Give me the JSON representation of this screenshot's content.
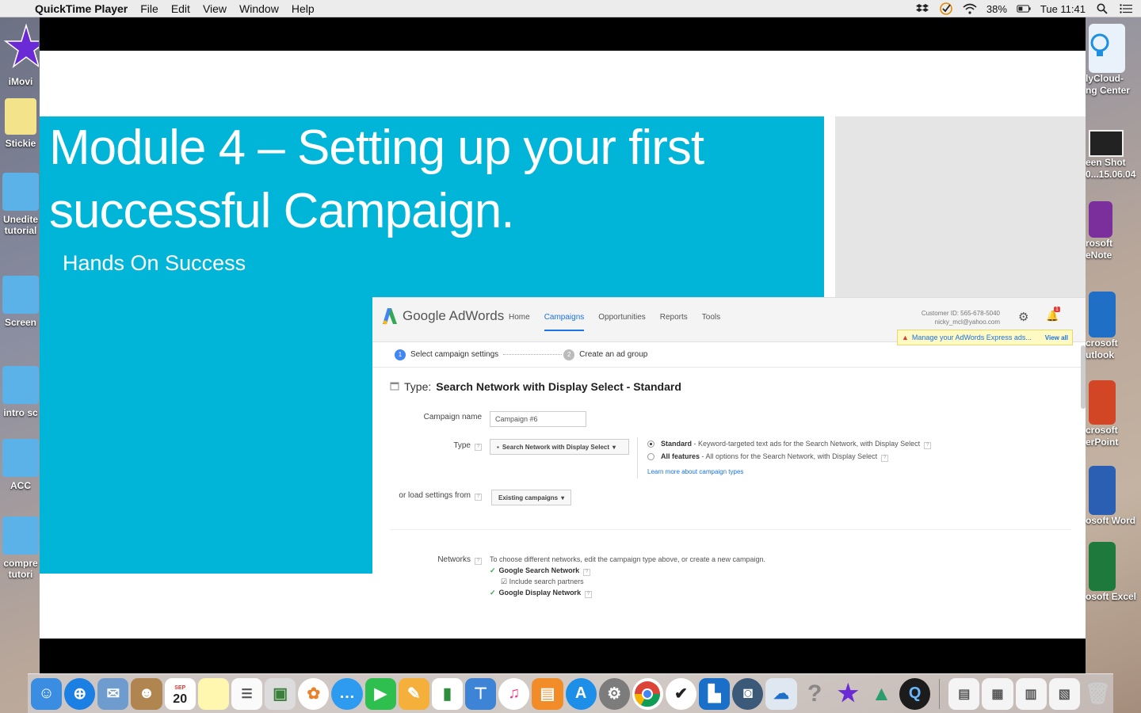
{
  "menubar": {
    "app_name": "QuickTime Player",
    "menus": [
      "File",
      "Edit",
      "View",
      "Window",
      "Help"
    ],
    "battery": "38%",
    "clock": "Tue 11:41"
  },
  "desktop_left": [
    {
      "label": "iMovi"
    },
    {
      "label": "Stickie"
    },
    {
      "label": "Unedite"
    },
    {
      "label": "tutorial"
    },
    {
      "label": "Screen"
    },
    {
      "label": "intro sc"
    },
    {
      "label": "ACC"
    },
    {
      "label": "compre"
    },
    {
      "label": "tutori"
    }
  ],
  "desktop_right": [
    {
      "label1": "lyCloud-",
      "label2": "ng Center"
    },
    {
      "label1": "een Shot",
      "label2": "0...15.06.04"
    },
    {
      "label1": "rosoft",
      "label2": "eNote"
    },
    {
      "label1": "crosoft",
      "label2": "utlook"
    },
    {
      "label1": "crosoft",
      "label2": "erPoint"
    },
    {
      "label1": "osoft Word",
      "label2": ""
    },
    {
      "label1": "osoft Excel",
      "label2": ""
    }
  ],
  "slide": {
    "title_line1": "Module 4 – Setting up your first",
    "title_line2": "successful Campaign.",
    "subtitle": "Hands On Success"
  },
  "adwords": {
    "logo": "Google AdWords",
    "nav": [
      "Home",
      "Campaigns",
      "Opportunities",
      "Reports",
      "Tools"
    ],
    "customer_id": "Customer ID: 565-678-5040",
    "email": "nicky_mcl@yahoo.com",
    "notification_count": "1",
    "alert": "Manage your AdWords Express ads...",
    "alert_link": "View all",
    "step1": "Select campaign settings",
    "step2": "Create an ad group",
    "type_label": "Type:",
    "type_value": "Search Network with Display Select - Standard",
    "campaign_name_label": "Campaign name",
    "campaign_name_value": "Campaign #6",
    "type_field_label": "Type",
    "type_dropdown": "Search Network with Display Select",
    "option_standard_name": "Standard",
    "option_standard_desc": " - Keyword-targeted text ads for the Search Network, with Display Select",
    "option_all_name": "All features",
    "option_all_desc": " - All options for the Search Network, with Display Select",
    "learn_more": "Learn more about campaign types",
    "load_label": "or load settings from",
    "load_button": "Existing campaigns",
    "networks_label": "Networks",
    "networks_hint": "To choose different networks, edit the campaign type above, or create a new campaign.",
    "network1": "Google Search Network",
    "network1_sub": "Include search partners",
    "network2": "Google Display Network"
  },
  "dock": {
    "calendar_month": "SEP",
    "calendar_day": "20"
  }
}
